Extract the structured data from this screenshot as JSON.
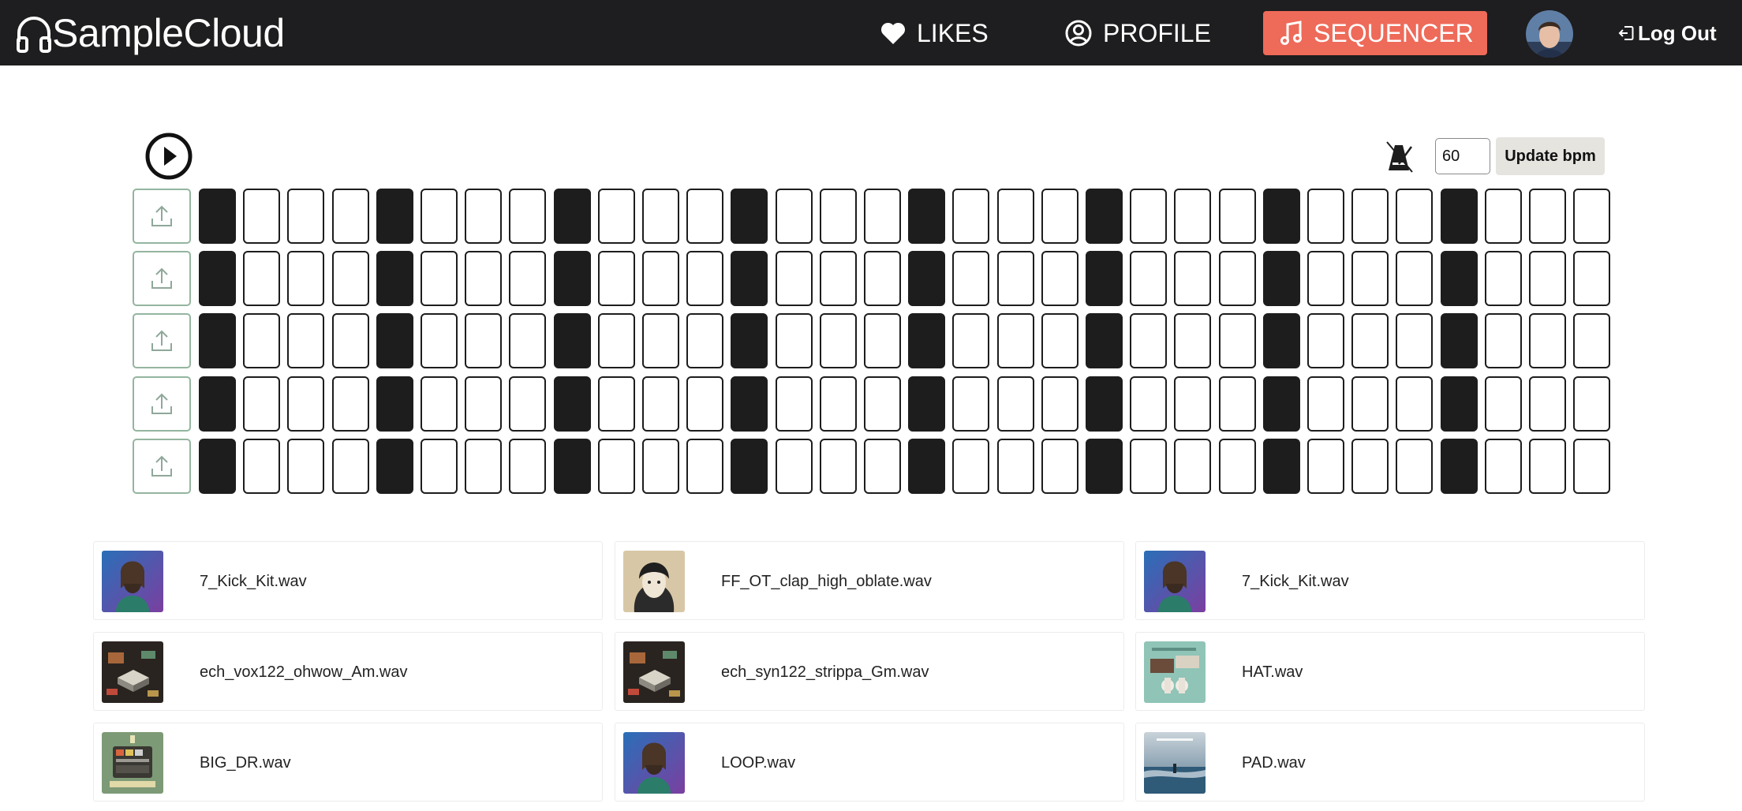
{
  "nav": {
    "brand": "SampleCloud",
    "likes": "LIKES",
    "profile": "PROFILE",
    "sequencer": "SEQUENCER",
    "logout": "Log Out"
  },
  "sequencer": {
    "bpm": "60",
    "update_label": "Update bpm",
    "rows": 5,
    "steps": 32,
    "active_steps": [
      0,
      4,
      8,
      12,
      16,
      20,
      24,
      28
    ]
  },
  "samples": [
    {
      "name": "7_Kick_Kit.wav",
      "art": "portrait-bearded-man"
    },
    {
      "name": "FF_OT_clap_high_oblate.wav",
      "art": "portrait-hooded-figure"
    },
    {
      "name": "7_Kick_Kit.wav",
      "art": "portrait-bearded-man"
    },
    {
      "name": "ech_vox122_ohwow_Am.wav",
      "art": "isometric-synth-cover"
    },
    {
      "name": "ech_syn122_strippa_Gm.wav",
      "art": "isometric-synth-cover"
    },
    {
      "name": "HAT.wav",
      "art": "teal-collage-cover"
    },
    {
      "name": "BIG_DR.wav",
      "art": "drum-machine-cover"
    },
    {
      "name": "LOOP.wav",
      "art": "portrait-bearded-man"
    },
    {
      "name": "PAD.wav",
      "art": "ocean-cover"
    }
  ],
  "colors": {
    "navbar": "#1e1d1f",
    "accent": "#ee6a59",
    "step_on": "#1d1d1d",
    "upload_border": "#94b59f"
  },
  "icons": [
    "headphones-icon",
    "heart-icon",
    "user-circle-icon",
    "music-note-icon",
    "logout-icon",
    "play-icon",
    "metronome-icon",
    "upload-icon"
  ]
}
